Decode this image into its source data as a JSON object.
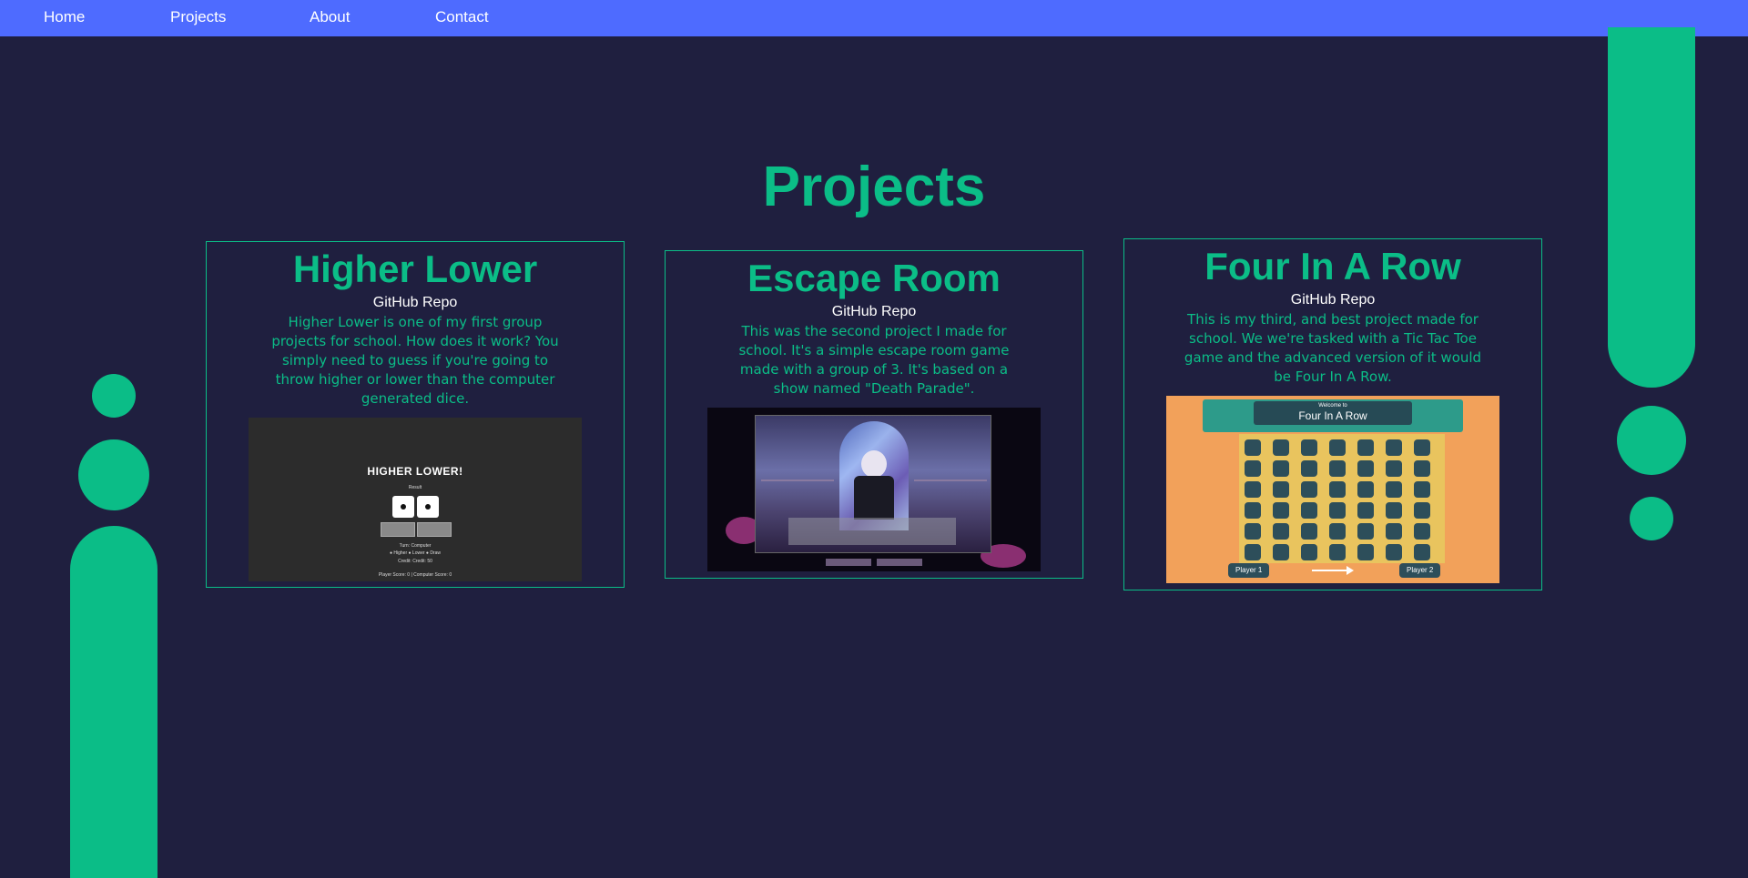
{
  "nav": {
    "items": [
      "Home",
      "Projects",
      "About",
      "Contact"
    ]
  },
  "page": {
    "title": "Projects"
  },
  "colors": {
    "background": "#1f1f3f",
    "navbar": "#4e6bff",
    "accent": "#0bbd87",
    "text_light": "#ffffff"
  },
  "projects": [
    {
      "title": "Higher Lower",
      "link": "GitHub Repo",
      "description": "Higher Lower is one of my first group projects for school. How does it work? You simply need to guess if you're going to throw higher or lower than the computer generated dice.",
      "screenshot": {
        "heading": "HIGHER LOWER!",
        "result_label": "Result",
        "turn_label": "Turn: Computer",
        "options": "● Higher ● Lower ● Draw",
        "credit": "Credit: Credit: 50",
        "score": "Player Score: 0 | Computer Score: 0"
      }
    },
    {
      "title": "Escape Room",
      "link": "GitHub Repo",
      "description": "This was the second project I made for school. It's a simple escape room game made with a group of 3. It's based on a show named \"Death Parade\"."
    },
    {
      "title": "Four In A Row",
      "link": "GitHub Repo",
      "description": "This is my third, and best project made for school. We we're tasked with a Tic Tac Toe game and the advanced version of it would be Four In A Row.",
      "screenshot": {
        "welcome_small": "Welcome to",
        "welcome_big": "Four In A Row",
        "player1": "Player 1",
        "player2": "Player 2"
      }
    }
  ]
}
